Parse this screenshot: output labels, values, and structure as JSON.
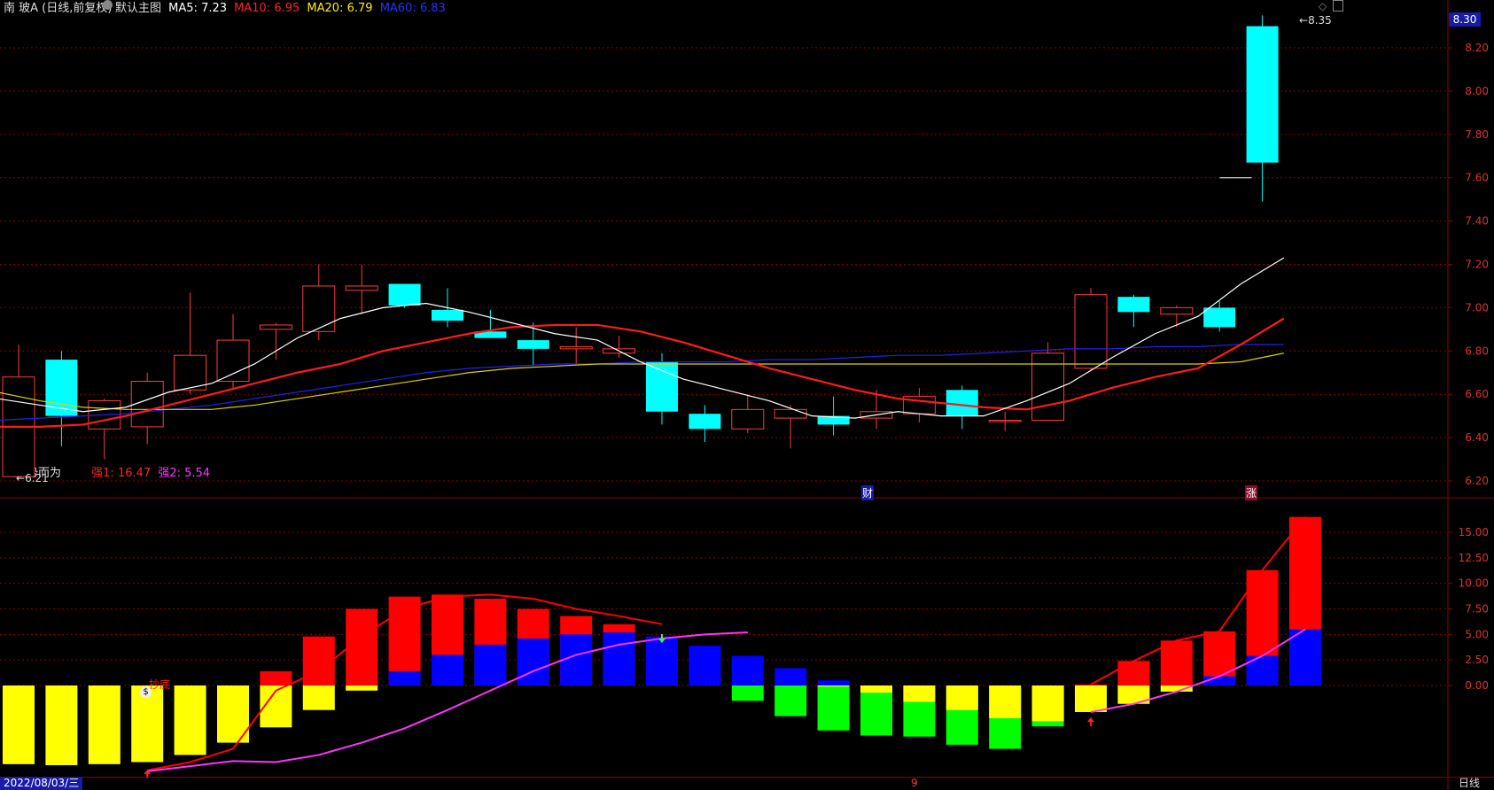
{
  "main_header": {
    "stock_name": "南 玻A",
    "period_note": "(日线,前复权)",
    "template_label": "默认主图",
    "ma5_label": "MA5:",
    "ma5_value": "7.23",
    "ma10_label": "MA10:",
    "ma10_value": "6.95",
    "ma20_label": "MA20:",
    "ma20_value": "6.79",
    "ma60_label": "MA60:",
    "ma60_value": "6.83"
  },
  "sub_header": {
    "indicator_name": "顺势而为",
    "s1_label": "强1:",
    "s1_value": "16.47",
    "s2_label": "强2:",
    "s2_value": "5.54"
  },
  "labels": {
    "low_price": "6.21",
    "high_price": "8.35",
    "current_price": "8.30",
    "finance_marker": "财",
    "rise_marker": "涨",
    "bottom_text": "抄底",
    "date": "2022/08/03/三",
    "mid_marker": "9",
    "period_button": "日线"
  },
  "colors": {
    "up": "#ff3b3b",
    "down": "#00ffff",
    "ma5": "#ffffff",
    "ma10": "#ff1a1a",
    "ma20": "#e0d000",
    "ma60": "#2222ee",
    "grid": "#8b0000",
    "yellow": "#ffff00",
    "blue": "#0000ff",
    "green": "#00ff00",
    "red": "#ff0000",
    "magenta": "#ff33ff"
  },
  "icons": [
    "collapse-icon",
    "diamond-icon",
    "window-icon",
    "up-arrow-icon",
    "down-arrow-icon",
    "money-bag-icon"
  ],
  "chart_data": [
    {
      "type": "candlestick",
      "title": "南 玻A (日线,前复权)",
      "ylim": [
        6.15,
        8.35
      ],
      "yticks": [
        "8.20",
        "8.00",
        "7.80",
        "7.60",
        "7.40",
        "7.20",
        "7.00",
        "6.80",
        "6.60",
        "6.40",
        "6.20"
      ],
      "candles": [
        {
          "o": 6.22,
          "h": 6.83,
          "l": 6.21,
          "c": 6.68
        },
        {
          "o": 6.76,
          "h": 6.8,
          "l": 6.36,
          "c": 6.5
        },
        {
          "o": 6.44,
          "h": 6.58,
          "l": 6.3,
          "c": 6.57
        },
        {
          "o": 6.45,
          "h": 6.7,
          "l": 6.37,
          "c": 6.66
        },
        {
          "o": 6.62,
          "h": 7.07,
          "l": 6.6,
          "c": 6.78
        },
        {
          "o": 6.66,
          "h": 6.97,
          "l": 6.63,
          "c": 6.85
        },
        {
          "o": 6.9,
          "h": 6.93,
          "l": 6.76,
          "c": 6.92
        },
        {
          "o": 6.89,
          "h": 7.2,
          "l": 6.85,
          "c": 7.1
        },
        {
          "o": 7.08,
          "h": 7.2,
          "l": 6.97,
          "c": 7.1
        },
        {
          "o": 7.11,
          "h": 7.11,
          "l": 7.0,
          "c": 7.01
        },
        {
          "o": 6.99,
          "h": 7.09,
          "l": 6.91,
          "c": 6.94
        },
        {
          "o": 6.89,
          "h": 6.99,
          "l": 6.86,
          "c": 6.86
        },
        {
          "o": 6.85,
          "h": 6.93,
          "l": 6.73,
          "c": 6.81
        },
        {
          "o": 6.81,
          "h": 6.91,
          "l": 6.74,
          "c": 6.82
        },
        {
          "o": 6.79,
          "h": 6.87,
          "l": 6.77,
          "c": 6.81
        },
        {
          "o": 6.75,
          "h": 6.79,
          "l": 6.46,
          "c": 6.52
        },
        {
          "o": 6.51,
          "h": 6.55,
          "l": 6.38,
          "c": 6.44
        },
        {
          "o": 6.44,
          "h": 6.6,
          "l": 6.42,
          "c": 6.53
        },
        {
          "o": 6.49,
          "h": 6.55,
          "l": 6.35,
          "c": 6.53
        },
        {
          "o": 6.5,
          "h": 6.59,
          "l": 6.41,
          "c": 6.46
        },
        {
          "o": 6.49,
          "h": 6.62,
          "l": 6.44,
          "c": 6.52
        },
        {
          "o": 6.51,
          "h": 6.63,
          "l": 6.47,
          "c": 6.59
        },
        {
          "o": 6.62,
          "h": 6.64,
          "l": 6.44,
          "c": 6.5
        },
        {
          "o": 6.48,
          "h": 6.52,
          "l": 6.43,
          "c": 6.48
        },
        {
          "o": 6.48,
          "h": 6.84,
          "l": 6.48,
          "c": 6.79
        },
        {
          "o": 6.72,
          "h": 7.09,
          "l": 6.71,
          "c": 7.06
        },
        {
          "o": 7.05,
          "h": 7.06,
          "l": 6.91,
          "c": 6.98
        },
        {
          "o": 6.97,
          "h": 7.01,
          "l": 6.91,
          "c": 7.0
        },
        {
          "o": 7.0,
          "h": 7.03,
          "l": 6.89,
          "c": 6.91
        },
        {
          "o": 8.3,
          "h": 8.35,
          "l": 7.49,
          "c": 7.67
        }
      ],
      "ma5": [
        6.58,
        6.55,
        6.52,
        6.54,
        6.61,
        6.65,
        6.74,
        6.86,
        6.95,
        7.0,
        7.02,
        6.98,
        6.93,
        6.88,
        6.85,
        6.75,
        6.67,
        6.62,
        6.57,
        6.5,
        6.49,
        6.52,
        6.5,
        6.5,
        6.57,
        6.65,
        6.77,
        6.88,
        6.96,
        7.11,
        7.23
      ],
      "ma10": [
        6.45,
        6.45,
        6.46,
        6.5,
        6.55,
        6.6,
        6.65,
        6.7,
        6.74,
        6.8,
        6.84,
        6.88,
        6.91,
        6.92,
        6.92,
        6.89,
        6.84,
        6.78,
        6.72,
        6.67,
        6.62,
        6.58,
        6.56,
        6.54,
        6.53,
        6.57,
        6.63,
        6.68,
        6.72,
        6.83,
        6.95
      ],
      "ma20": [
        6.61,
        6.57,
        6.54,
        6.53,
        6.53,
        6.53,
        6.55,
        6.58,
        6.61,
        6.64,
        6.67,
        6.7,
        6.72,
        6.73,
        6.74,
        6.74,
        6.74,
        6.74,
        6.74,
        6.74,
        6.74,
        6.74,
        6.74,
        6.74,
        6.74,
        6.74,
        6.74,
        6.74,
        6.74,
        6.75,
        6.79
      ],
      "ma60": [
        6.48,
        6.49,
        6.5,
        6.51,
        6.53,
        6.55,
        6.58,
        6.61,
        6.64,
        6.67,
        6.7,
        6.72,
        6.73,
        6.74,
        6.74,
        6.75,
        6.75,
        6.75,
        6.76,
        6.76,
        6.77,
        6.78,
        6.78,
        6.79,
        6.8,
        6.81,
        6.81,
        6.82,
        6.82,
        6.83,
        6.83
      ]
    },
    {
      "type": "bar",
      "title": "顺势而为",
      "ylim": [
        -8.8,
        16.5
      ],
      "yticks": [
        "15.00",
        "12.50",
        "10.00",
        "7.50",
        "5.00",
        "2.50",
        "0.00"
      ],
      "bars": [
        {
          "yellow": -7.7,
          "green": -0.3
        },
        {
          "yellow": -7.8
        },
        {
          "yellow": -7.7,
          "green": -0.2
        },
        {
          "yellow": -7.5
        },
        {
          "yellow": -6.8
        },
        {
          "yellow": -5.6
        },
        {
          "yellow": -4.1,
          "red": 1.4
        },
        {
          "yellow": -2.4,
          "red": 4.8
        },
        {
          "yellow": -0.5,
          "red": 7.5
        },
        {
          "blue": 1.4,
          "red": 8.7
        },
        {
          "blue": 3.0,
          "red": 8.9
        },
        {
          "blue": 4.0,
          "red": 8.5
        },
        {
          "blue": 4.6,
          "red": 7.5
        },
        {
          "blue": 5.0,
          "red": 6.8
        },
        {
          "blue": 5.2,
          "red": 6.0
        },
        {
          "blue": 4.8
        },
        {
          "blue": 3.9
        },
        {
          "blue": 2.9,
          "green": -1.5
        },
        {
          "blue": 1.7,
          "green": -3.0
        },
        {
          "blue": 0.5,
          "yellow": -0.1,
          "green": -4.4
        },
        {
          "yellow": -0.7,
          "green": -4.9
        },
        {
          "yellow": -1.6,
          "green": -5.0
        },
        {
          "yellow": -2.4,
          "green": -5.8
        },
        {
          "yellow": -3.2,
          "green": -6.2
        },
        {
          "yellow": -3.5,
          "green": -4.0
        },
        {
          "yellow": -2.6,
          "red": 0.1
        },
        {
          "yellow": -1.8,
          "red": 2.4
        },
        {
          "yellow": -0.6,
          "red": 4.4
        },
        {
          "blue": 0.9,
          "red": 5.3
        },
        {
          "blue": 2.9,
          "red": 11.3
        },
        {
          "blue": 5.5,
          "red": 16.5
        }
      ],
      "s1_line_start": 7,
      "s1_line": [
        -6.2,
        -4.2,
        -2.3,
        -0.5,
        1.4,
        4.8,
        7.5,
        8.7,
        8.9,
        8.5,
        7.5,
        6.8,
        6.0
      ],
      "s1_line2_start": 25,
      "s1_line2": [
        0.1,
        2.4,
        4.4,
        5.3,
        11.3,
        16.5
      ],
      "s2_line": [
        -7.5,
        -6.8,
        -5.6,
        -4.2,
        -2.4,
        -0.5,
        1.4,
        3.0,
        4.0,
        4.6,
        5.0,
        5.2
      ],
      "s2_line_start": 3,
      "s2_line2_start": 25,
      "s2_line2": [
        -2.6,
        -1.8,
        -0.6,
        0.9,
        2.9,
        5.5
      ]
    }
  ]
}
